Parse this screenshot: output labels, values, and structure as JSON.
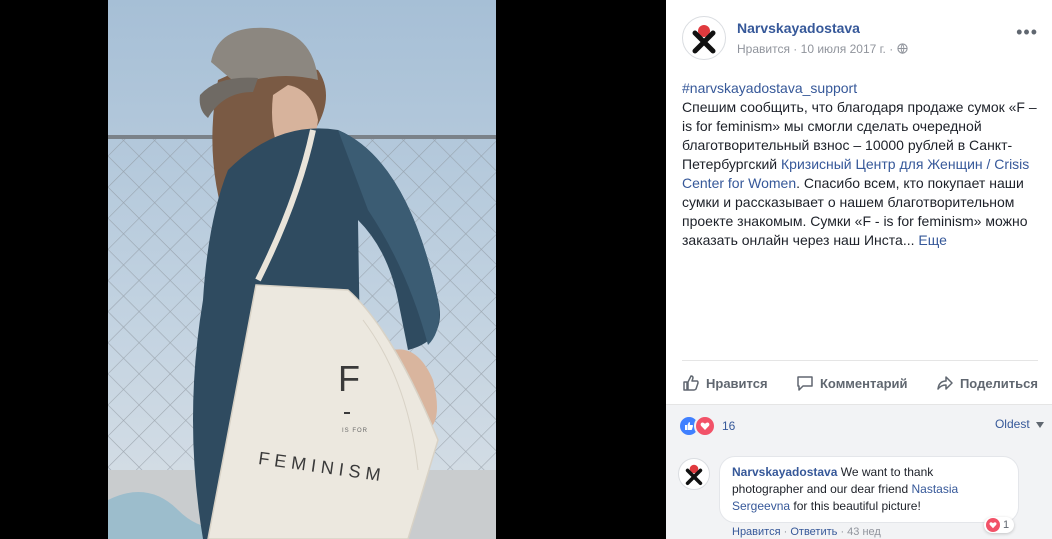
{
  "post": {
    "page_name": "Narvskayadostava",
    "like_label": "Нравится",
    "date": "10 июля 2017 г.",
    "separator": "·",
    "options_label": "•••",
    "hashtag": "#narvskayadostava_support",
    "text_1": "Спешим сообщить, что благодаря продаже сумок «F – is for feminism» мы смогли сделать очередной благотворительный взнос – 10000 рублей в Санкт-Петербургский",
    "link_text": "Кризисный Центр для Женщин / Crisis Center for Women",
    "text_2": ". Спасибо всем, кто покупает наши сумки и рассказывает о нашем благотворительном проекте знакомым. Сумки «F - is for feminism» можно заказать онлайн через наш Инста",
    "ellipsis": "...",
    "more_label": "Еще"
  },
  "photo": {
    "bag_letter": "F",
    "bag_small": "IS FOR",
    "bag_word": "FEMINISM"
  },
  "actions": {
    "like": "Нравится",
    "comment": "Комментарий",
    "share": "Поделиться"
  },
  "reactions": {
    "count": "16",
    "sort_label": "Oldest"
  },
  "comment": {
    "author": "Narvskayadostava",
    "text_1": "We want to thank photographer and our dear friend",
    "mention": "Nastasia Sergeevna",
    "text_2": "for this beautiful picture!",
    "reaction_count": "1",
    "like_link": "Нравится",
    "reply_link": "Ответить",
    "time": "43 нед"
  },
  "colors": {
    "link": "#365899",
    "like": "#4080ff",
    "love": "#f25268"
  }
}
